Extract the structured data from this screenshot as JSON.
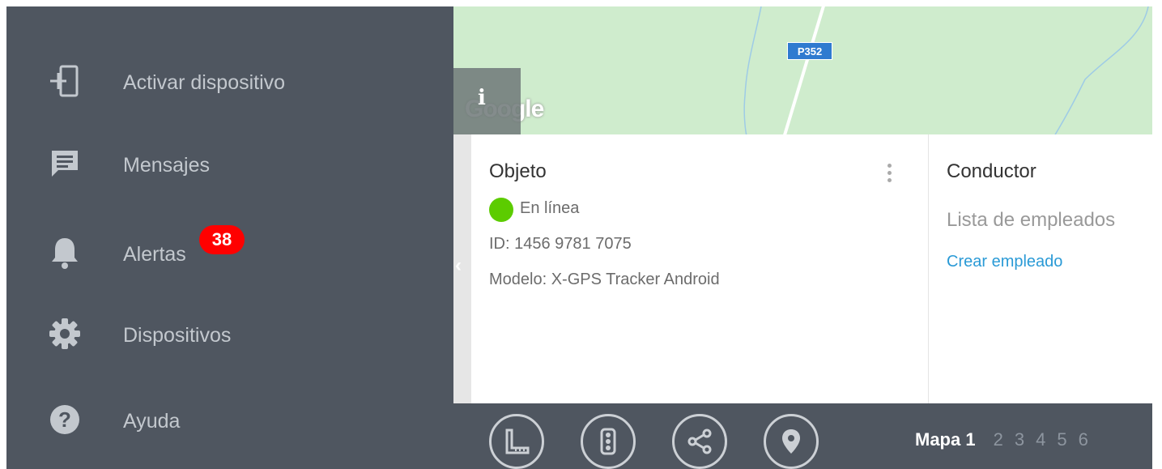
{
  "sidebar": {
    "items": [
      {
        "label": "Activar dispositivo",
        "icon": "login-device-icon"
      },
      {
        "label": "Mensajes",
        "icon": "message-icon"
      },
      {
        "label": "Alertas",
        "icon": "bell-icon",
        "badge": "38"
      },
      {
        "label": "Dispositivos",
        "icon": "gear-icon"
      },
      {
        "label": "Ayuda",
        "icon": "help-icon"
      }
    ]
  },
  "map": {
    "road_sign": "P352",
    "info_button": "i",
    "attribution": "Google",
    "colors": {
      "land": "#cfeccd",
      "road": "#ffffff",
      "river": "#9ecbe6"
    }
  },
  "object_card": {
    "title": "Objeto",
    "status": "En línea",
    "status_color": "#5ccc00",
    "id_text": "ID: 1456 9781 7075",
    "model_text": "Modelo: X-GPS Tracker Android"
  },
  "driver_card": {
    "title": "Conductor",
    "list_text": "Lista de empleados",
    "create_link": "Crear empleado"
  },
  "toolbar": {
    "tools": [
      "ruler-icon",
      "traffic-light-icon",
      "share-icon",
      "location-pin-icon"
    ],
    "map_tabs": [
      {
        "label": "Mapa 1",
        "active": true
      },
      {
        "label": "2",
        "active": false
      },
      {
        "label": "3",
        "active": false
      },
      {
        "label": "4",
        "active": false
      },
      {
        "label": "5",
        "active": false
      },
      {
        "label": "6",
        "active": false
      }
    ]
  },
  "colors": {
    "sidebar_bg": "#4f5660",
    "badge": "#ff0000",
    "link": "#2a9ad6"
  }
}
